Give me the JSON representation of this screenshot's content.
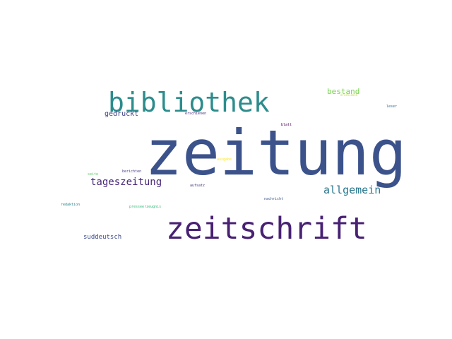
{
  "word_cloud": {
    "words": [
      {
        "text": "zeitung",
        "color": "#3b528b"
      },
      {
        "text": "zeitschrift",
        "color": "#482173"
      },
      {
        "text": "bibliothek",
        "color": "#2c8c8c"
      },
      {
        "text": "allgemein",
        "color": "#2a788e"
      },
      {
        "text": "tageszeitung",
        "color": "#482878"
      },
      {
        "text": "bestand",
        "color": "#7ad151"
      },
      {
        "text": "gedruckt",
        "color": "#414487"
      },
      {
        "text": "suddeutsch",
        "color": "#3e4a89"
      },
      {
        "text": "erschienen",
        "color": "#472d7b"
      },
      {
        "text": "blatt",
        "color": "#440154"
      },
      {
        "text": "leser",
        "color": "#31688e"
      },
      {
        "text": "erschienen",
        "color": "#b5de2b"
      },
      {
        "text": "berichten",
        "color": "#443983"
      },
      {
        "text": "seite",
        "color": "#5ec962"
      },
      {
        "text": "ausgabe",
        "color": "#fde725"
      },
      {
        "text": "aufsatz",
        "color": "#46327e"
      },
      {
        "text": "nachricht",
        "color": "#3b528b"
      },
      {
        "text": "redaktion",
        "color": "#26828e"
      },
      {
        "text": "presseerzeugnis",
        "color": "#35b779"
      }
    ]
  }
}
